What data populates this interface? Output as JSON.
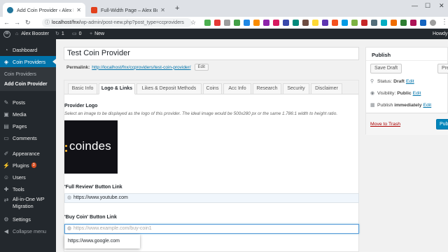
{
  "browser": {
    "tabs": [
      {
        "title": "Add Coin Provider ‹ Alex Booster",
        "active": true
      },
      {
        "title": "Full-Width Page – Alex Booster",
        "active": false
      }
    ],
    "new_tab": "+",
    "url_host": "localhost/fnx/",
    "url_path": "wp-admin/post-new.php?post_type=ccproviders"
  },
  "adminbar": {
    "site_name": "Alex Booster",
    "updates_count": "1",
    "comments_count": "0",
    "new_label": "New",
    "howdy": "Howdy"
  },
  "sidebar": {
    "items": [
      {
        "label": "Dashboard",
        "icon": "dashboard-icon"
      },
      {
        "label": "Coin Providers",
        "icon": "coin-providers-icon"
      },
      {
        "label": "Posts",
        "icon": "pin-icon"
      },
      {
        "label": "Media",
        "icon": "media-icon"
      },
      {
        "label": "Pages",
        "icon": "pages-icon"
      },
      {
        "label": "Comments",
        "icon": "comments-icon"
      },
      {
        "label": "Appearance",
        "icon": "brush-icon"
      },
      {
        "label": "Plugins",
        "icon": "plugin-icon",
        "badge": "3"
      },
      {
        "label": "Users",
        "icon": "users-icon"
      },
      {
        "label": "Tools",
        "icon": "wrench-icon"
      },
      {
        "label": "All-in-One WP",
        "label2": "Migration",
        "icon": "migration-icon"
      },
      {
        "label": "Settings",
        "icon": "settings-icon"
      },
      {
        "label": "Collapse menu",
        "icon": "collapse-icon"
      }
    ],
    "submenu": [
      "Coin Providers",
      "Add Coin Provider"
    ]
  },
  "editor": {
    "title_value": "Test Coin Provider",
    "permalink_label": "Permalink:",
    "permalink_base": "http://localhost/fnx/ccproviders/",
    "permalink_slug": "test-coin-provider",
    "permalink_end": "/",
    "edit_label": "Edit"
  },
  "metabox": {
    "tabs": [
      "Basic Info",
      "Logo & Links",
      "Likes & Deposit Methods",
      "Coins",
      "Acc Info",
      "Research",
      "Security",
      "Disclaimer"
    ],
    "provider_logo_label": "Provider Logo",
    "provider_logo_desc": "Select an image to be displayed as the logo of this provider. The ideal image would be 500x280 px or the same 1.786:1 width to height ratio.",
    "logo_text": "coindes",
    "full_review_label": "'Full Review' Button Link",
    "full_review_value": "https://www.youtube.com",
    "buy_coin_label": "'Buy Coin' Button Link",
    "buy_coin_placeholder": "https://www.example.com/buy-coin1",
    "autocomplete_suggestion": "https://www.google.com"
  },
  "publish": {
    "heading": "Publish",
    "save_draft": "Save Draft",
    "preview": "Preview",
    "status_label": "Status:",
    "status_value": "Draft",
    "visibility_label": "Visibility:",
    "visibility_value": "Public",
    "publish_label": "Publish",
    "publish_value": "immediately",
    "edit_link": "Edit",
    "move_to_trash": "Move to Trash",
    "publish_button": "Publish"
  },
  "colors": {
    "admin_dark": "#23282d",
    "accent_blue": "#0073aa",
    "badge_orange": "#d54e21"
  }
}
